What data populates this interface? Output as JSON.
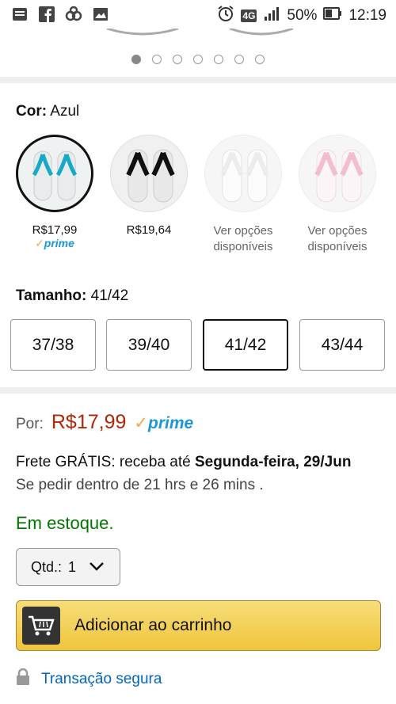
{
  "status_bar": {
    "battery": "50%",
    "time": "12:19",
    "network": "4G"
  },
  "carousel": {
    "total_dots": 7,
    "active_index": 0
  },
  "color": {
    "label": "Cor:",
    "value": "Azul",
    "options": [
      {
        "name": "azul",
        "price": "R$17,99",
        "prime": "prime",
        "selected": true
      },
      {
        "name": "preto",
        "price": "R$19,64",
        "selected": false
      },
      {
        "name": "branco",
        "line1": "Ver opções",
        "line2": "disponíveis",
        "selected": false
      },
      {
        "name": "rosa",
        "line1": "Ver opções",
        "line2": "disponíveis",
        "selected": false
      }
    ]
  },
  "size": {
    "label": "Tamanho:",
    "value": "41/42",
    "options": [
      "37/38",
      "39/40",
      "41/42",
      "43/44"
    ],
    "selected_index": 2
  },
  "buybox": {
    "por_label": "Por:",
    "price": "R$17,99",
    "prime": "prime",
    "frete_prefix": "Frete GRÁTIS: receba até ",
    "frete_date": "Segunda-feira, 29/Jun",
    "pedir": "Se pedir dentro de 21 hrs e 26 mins .",
    "stock": "Em estoque.",
    "qty_label": "Qtd.:",
    "qty_value": "1",
    "add_to_cart": "Adicionar ao carrinho",
    "secure": "Transação segura"
  },
  "colors": {
    "price_red": "#b12704",
    "prime_blue": "#1a98d5",
    "stock_green": "#007600",
    "link_blue": "#0066c0",
    "cart_yellow": "#f0c14b"
  }
}
